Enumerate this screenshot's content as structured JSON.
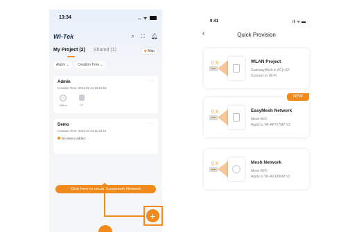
{
  "left_phone": {
    "status": {
      "time": "13:34",
      "icons": "‥ ᯤ"
    },
    "brand": {
      "logo_main": "Wi-Tek",
      "logo_dot": ""
    },
    "tabs": [
      {
        "label": "My Project (2)"
      },
      {
        "label": "Shared (1)"
      }
    ],
    "map_label": "Map",
    "filters": [
      "Alarm ⌄",
      "Creation Time ⌄"
    ],
    "projects": [
      {
        "name": "Admin",
        "creation_time": "Creation Time: 2024-02-14 16:51:53",
        "devices": [
          {
            "label": "Offline"
          },
          {
            "label": "0/1"
          }
        ]
      },
      {
        "name": "Demo",
        "creation_time": "Creation Time: 2023-10-24 11:34:16",
        "status": "No device added."
      }
    ],
    "create_button": "Click here to create Easymesh Network",
    "add_button": "+"
  },
  "right_phone": {
    "status": {
      "time": "9:41",
      "icons": "ıll ᯤ ▬"
    },
    "back_icon": "‹",
    "title": "Quick Provision",
    "options": [
      {
        "title": "WLAN Project",
        "line1": "Gateway(Built-in AC)+AP",
        "line2": "Connect to Wi-Fi"
      },
      {
        "title": "EasyMesh Network",
        "line1": "Mesh WiFi",
        "line2": "Apply to WI-AP717MP V2",
        "badge": "NEW"
      },
      {
        "title": "Mesh Network",
        "line1": "Mesh WiFi",
        "line2": "Apply to WI-AX1800M V2"
      }
    ]
  },
  "colors": {
    "accent": "#f08a1c",
    "brand_dark": "#1b2b45"
  },
  "icons": [
    "search-icon",
    "scan-icon",
    "bell-icon",
    "map-pin-icon",
    "globe-icon",
    "device-icon",
    "back-arrow-icon",
    "router-icon",
    "wifi-icon",
    "plus-icon"
  ]
}
